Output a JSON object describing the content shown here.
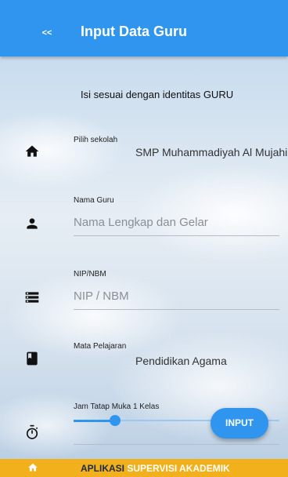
{
  "header": {
    "back_label": "<<",
    "title": "Input Data Guru"
  },
  "form": {
    "subtitle": "Isi sesuai dengan identitas GURU",
    "school": {
      "label": "Pilih sekolah",
      "value": "SMP Muhammadiyah Al Mujahi..."
    },
    "name": {
      "label": "Nama Guru",
      "placeholder": "Nama Lengkap dan Gelar"
    },
    "nip": {
      "label": "NIP/NBM",
      "placeholder": "NIP / NBM"
    },
    "subject": {
      "label": "Mata Pelajaran",
      "value": "Pendidikan Agama"
    },
    "hours": {
      "label": "Jam Tatap Muka 1 Kelas",
      "slider_fraction": 0.2
    },
    "submit_label": "INPUT"
  },
  "footer": {
    "text_part1": "APLIKASI",
    "text_part2": "SUPERVISI AKADEMIK"
  },
  "icons": {
    "school": "home-icon",
    "name": "person-icon",
    "nip": "storage-icon",
    "subject": "book-icon",
    "hours": "timer-icon",
    "footer": "home-icon"
  },
  "colors": {
    "primary": "#2f95ee",
    "footer": "#f2b01c"
  }
}
